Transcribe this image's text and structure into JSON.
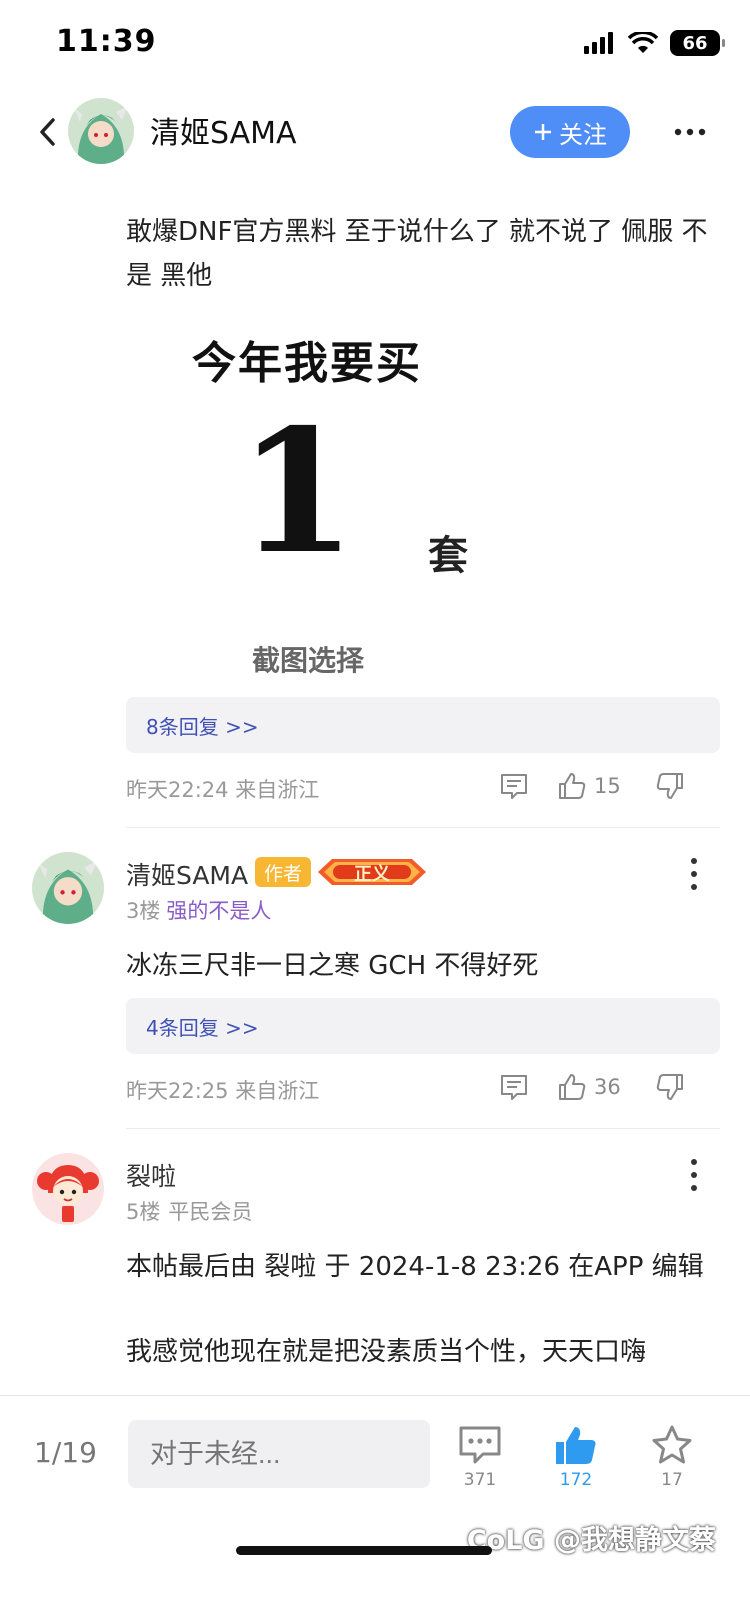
{
  "status_bar": {
    "time": "11:39",
    "battery": "66"
  },
  "header": {
    "username": "清姬SAMA",
    "follow_label": "关注"
  },
  "post": {
    "text": "敢爆DNF官方黑料  至于说什么了 就不说了 佩服                    不是 黑他",
    "image": {
      "line1": "今年我要买",
      "number": "1",
      "unit": "套",
      "caption": "截图选择"
    },
    "reply_link": "8条回复 >>",
    "time_location": "昨天22:24 来自浙江",
    "likes": "15"
  },
  "comments": [
    {
      "name": "清姬SAMA",
      "author_tag": "作者",
      "badge_text": "正义",
      "floor": "3楼",
      "level": "强的不是人",
      "text": "冰冻三尺非一日之寒    GCH 不得好死",
      "reply_link": "4条回复 >>",
      "time_location": "昨天22:25 来自浙江",
      "likes": "36"
    },
    {
      "name": "裂啦",
      "floor": "5楼",
      "level": "平民会员",
      "edit_note": "本帖最后由 裂啦 于 2024-1-8 23:26 在APP 编辑",
      "text": "我感觉他现在就是把没素质当个性，天天口嗨"
    }
  ],
  "bottom_bar": {
    "page": "1/19",
    "input_placeholder": "对于未经...",
    "comment_count": "371",
    "like_count": "172",
    "favorite_count": "17"
  },
  "watermark": "CoLG @我想静文蔡",
  "colors": {
    "accent": "#4f8ef7",
    "link": "#3f51b5",
    "author_tag": "#f7b733",
    "level_purple": "#8a5cc7",
    "like_active": "#2f9bf0"
  },
  "icons": [
    "back-arrow-icon",
    "more-dots-icon",
    "comment-icon",
    "thumbs-up-icon",
    "thumbs-down-icon",
    "star-icon",
    "signal-icon",
    "wifi-icon",
    "battery-icon"
  ]
}
